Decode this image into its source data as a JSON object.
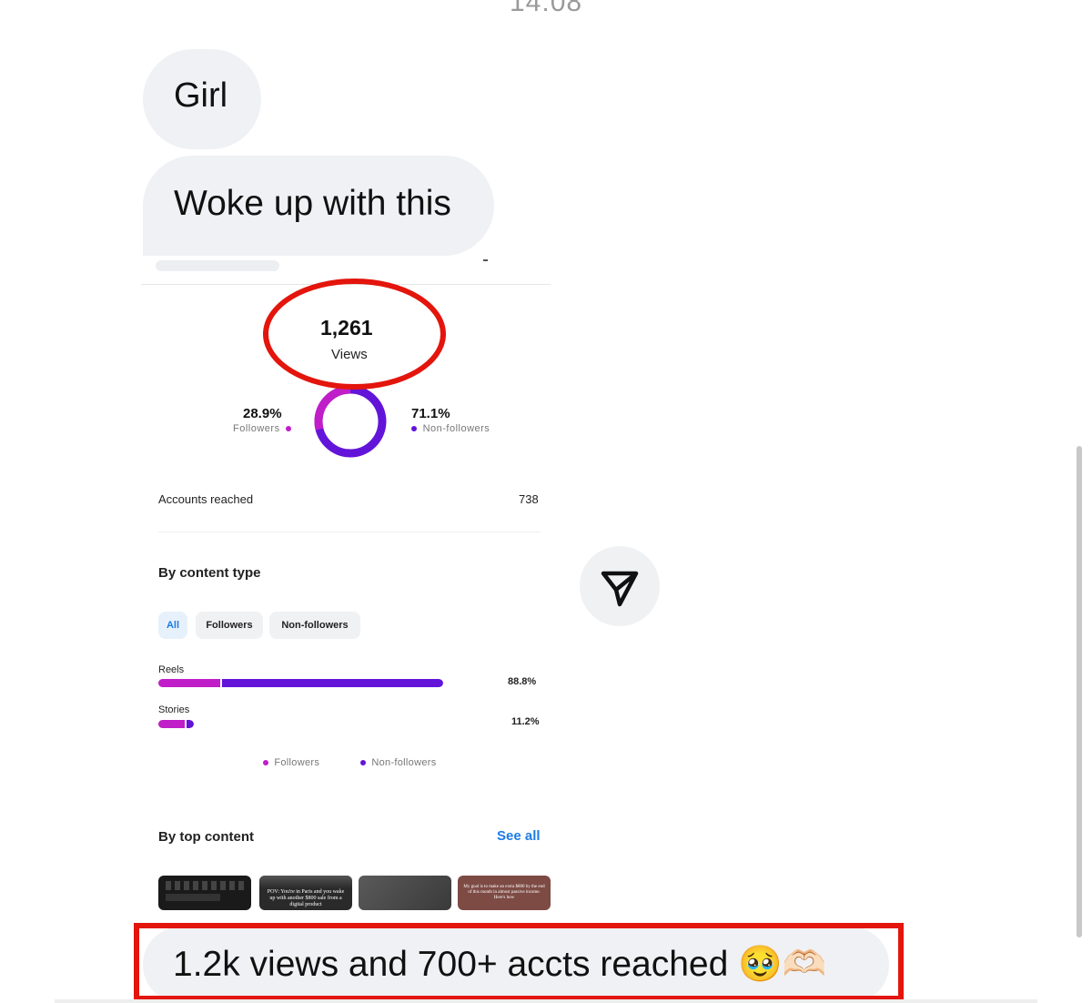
{
  "status": {
    "time": "14:08"
  },
  "messages": [
    {
      "text": "Girl"
    },
    {
      "text": "Woke up with this"
    },
    {
      "text": "1.2k views and 700+ accts reached 🥹🫶🏻"
    }
  ],
  "insights": {
    "views_value": "1,261",
    "views_label": "Views",
    "followers_pct": "28.9%",
    "followers_label": "Followers",
    "nonfollowers_pct": "71.1%",
    "nonfollowers_label": "Non-followers",
    "accounts_reached_label": "Accounts reached",
    "accounts_reached_value": "738",
    "by_content_type_title": "By content type",
    "chips": [
      "All",
      "Followers",
      "Non-followers"
    ],
    "content_rows": [
      {
        "label": "Reels",
        "value": "88.8%",
        "bar_fraction": 0.888,
        "followers_fraction": 0.22
      },
      {
        "label": "Stories",
        "value": "11.2%",
        "bar_fraction": 0.112,
        "followers_fraction": 0.78
      }
    ],
    "legend_followers": "Followers",
    "legend_nonfollowers": "Non-followers",
    "by_top_content_title": "By top content",
    "see_all_label": "See all",
    "thumb_captions": [
      "",
      "POV: You're in Paris and you wake up with another $800 sale from a digital product",
      "",
      "My goal is to make an extra $800 by the end of this month in almost passive income. Here's how"
    ]
  },
  "colors": {
    "followers": "#c01ec8",
    "nonfollowers": "#6314d9",
    "accent_blue": "#1d7ce6",
    "highlight_red": "#e3150c",
    "bubble_gray": "#eff1f4"
  },
  "icons": {
    "share": "paper-plane-icon"
  }
}
